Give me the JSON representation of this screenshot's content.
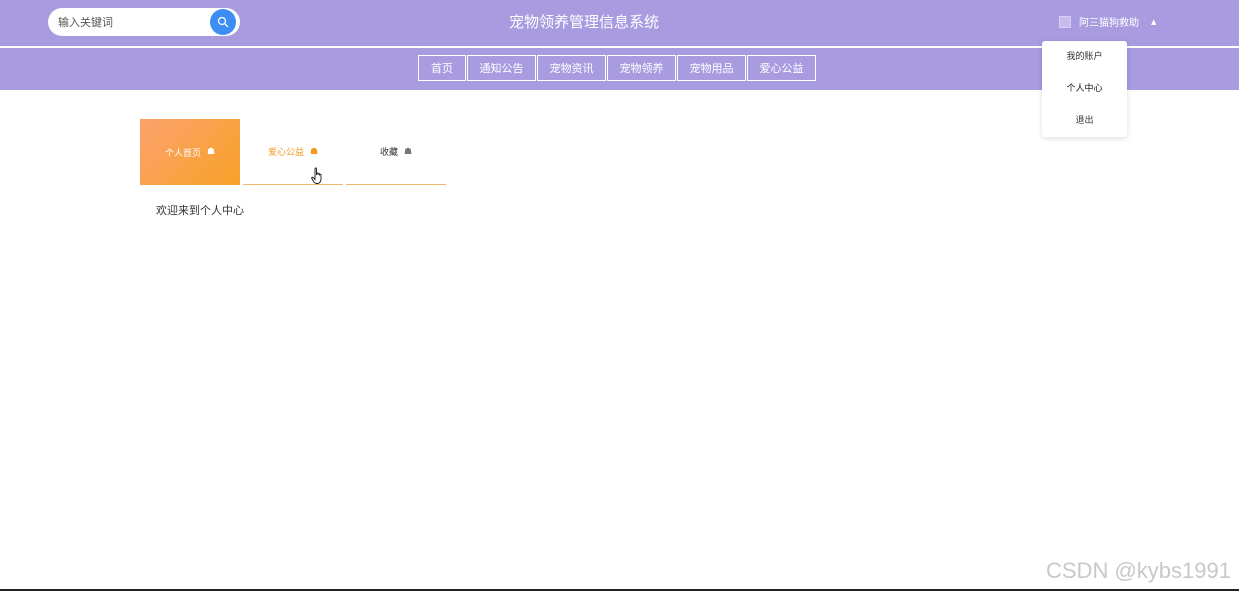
{
  "search": {
    "placeholder": "输入关键词",
    "icon": "search-icon"
  },
  "header": {
    "title": "宠物领养管理信息系统",
    "background": "#a99be0"
  },
  "user": {
    "name": "阿三猫狗救助",
    "caret": "▲"
  },
  "nav": {
    "items": [
      {
        "label": "首页"
      },
      {
        "label": "通知公告"
      },
      {
        "label": "宠物资讯"
      },
      {
        "label": "宠物领养"
      },
      {
        "label": "宠物用品"
      },
      {
        "label": "爱心公益"
      }
    ]
  },
  "dropdown": {
    "items": [
      {
        "label": "我的账户"
      },
      {
        "label": "个人中心"
      },
      {
        "label": "退出"
      }
    ]
  },
  "tabs": [
    {
      "label": "个人首页",
      "icon": "home-icon",
      "state": "active"
    },
    {
      "label": "爱心公益",
      "icon": "home-icon",
      "state": "hover"
    },
    {
      "label": "收藏",
      "icon": "home-icon",
      "state": "normal"
    }
  ],
  "main": {
    "welcome": "欢迎来到个人中心"
  },
  "watermark": "CSDN @kybs1991",
  "colors": {
    "accent": "#a99be0",
    "search_button": "#3c8ef5",
    "tab_active_start": "#fba26e",
    "tab_active_end": "#f7a227",
    "tab_hover": "#f39a1f"
  }
}
